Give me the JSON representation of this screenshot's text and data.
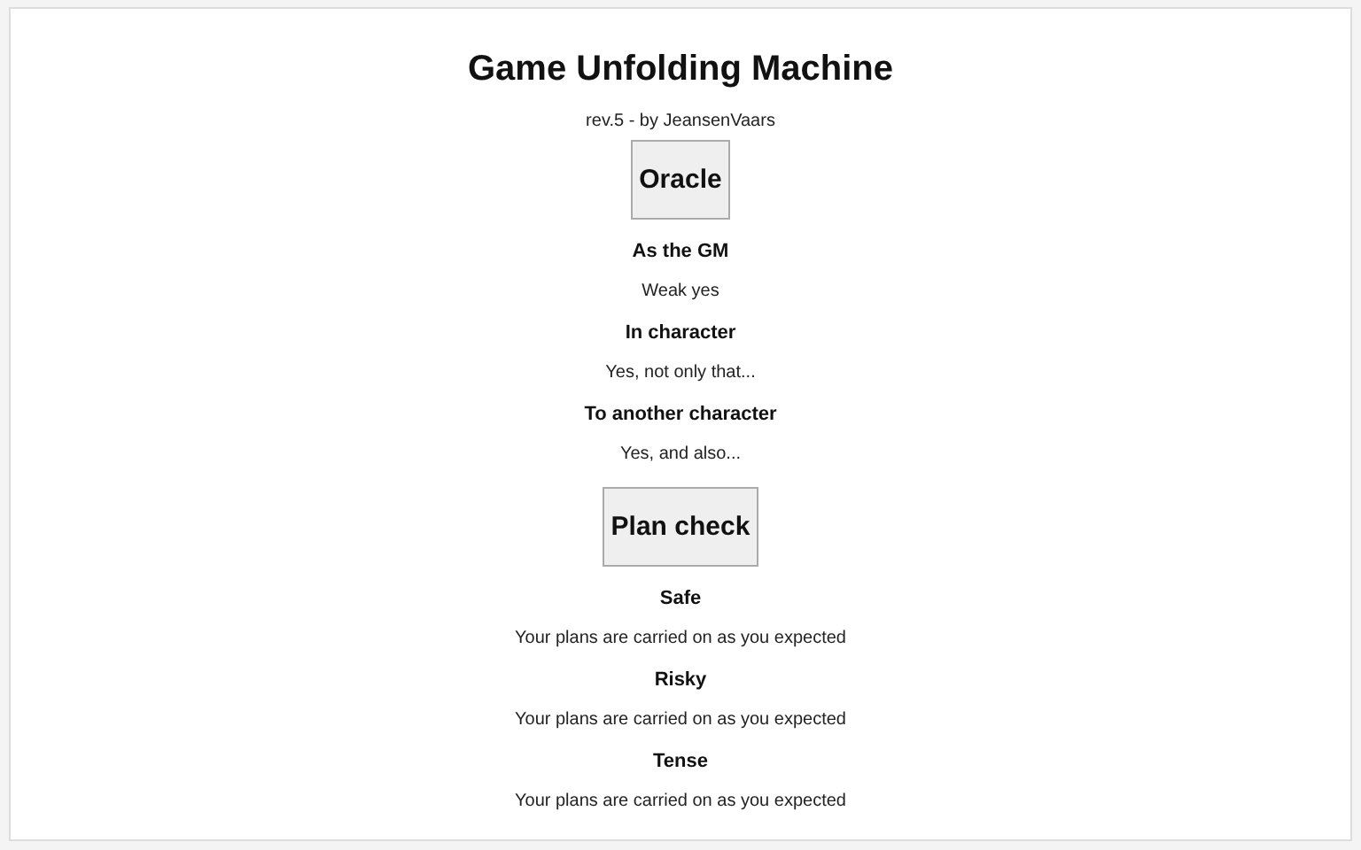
{
  "title": "Game Unfolding Machine",
  "subtitle": "rev.5 - by JeansenVaars",
  "sections": [
    {
      "button": "Oracle",
      "results": [
        {
          "heading": "As the GM",
          "text": "Weak yes"
        },
        {
          "heading": "In character",
          "text": "Yes, not only that..."
        },
        {
          "heading": "To another character",
          "text": "Yes, and also..."
        }
      ]
    },
    {
      "button": "Plan check",
      "results": [
        {
          "heading": "Safe",
          "text": "Your plans are carried on as you expected"
        },
        {
          "heading": "Risky",
          "text": "Your plans are carried on as you expected"
        },
        {
          "heading": "Tense",
          "text": "Your plans are carried on as you expected"
        }
      ]
    }
  ]
}
